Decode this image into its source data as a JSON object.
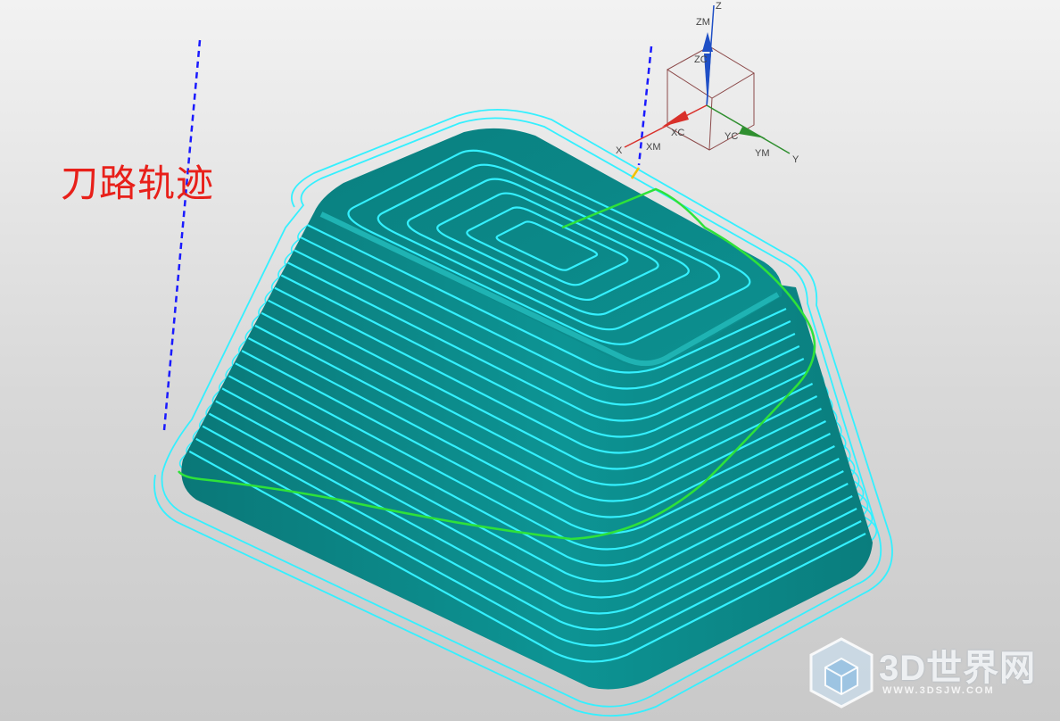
{
  "annotation": {
    "text": "刀路轨迹",
    "color": "#e8201a"
  },
  "triad": {
    "labels": {
      "zm": "ZM",
      "zc": "ZC",
      "z": "Z",
      "xc": "XC",
      "xm": "XM",
      "x": "X",
      "yc": "YC",
      "ym": "YM",
      "y": "Y"
    },
    "colors": {
      "x": "#d9302a",
      "y": "#2f8f2f",
      "z": "#1f4fc6"
    }
  },
  "model": {
    "body_color": "#0b8a8a",
    "toolpath_color": "#34f0ff",
    "engage_color": "#2ee23a",
    "axis_dash_color": "#1a1aff",
    "spiral_rings": 6,
    "wall_levels": 19
  },
  "watermark": {
    "title": "3D世界网",
    "url": "WWW.3DSJW.COM",
    "logo_icon": "cube-logo-icon"
  }
}
